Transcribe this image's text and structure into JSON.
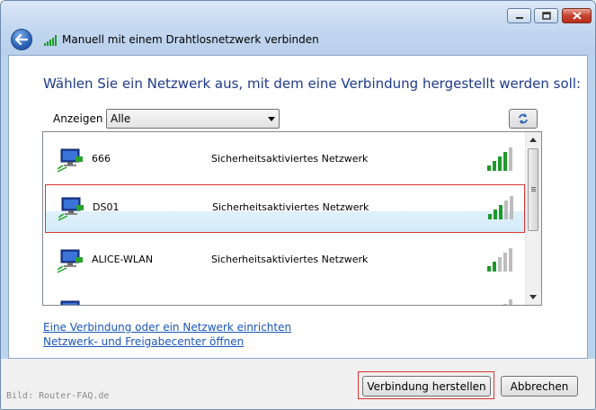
{
  "window": {
    "title": "Manuell mit einem Drahtlosnetzwerk verbinden",
    "controls": [
      "minimize",
      "maximize",
      "close"
    ]
  },
  "main": {
    "heading": "Wählen Sie ein Netzwerk aus, mit dem eine Verbindung hergestellt werden soll:",
    "filter": {
      "label": "Anzeigen",
      "value": "Alle"
    },
    "networks": [
      {
        "name": "666",
        "security": "Sicherheitsaktiviertes Netzwerk",
        "signal_level": 4,
        "selected": false
      },
      {
        "name": "DS01",
        "security": "Sicherheitsaktiviertes Netzwerk",
        "signal_level": 3,
        "selected": true
      },
      {
        "name": "ALICE-WLAN",
        "security": "Sicherheitsaktiviertes Netzwerk",
        "signal_level": 2,
        "selected": false
      }
    ],
    "links": [
      "Eine Verbindung oder ein Netzwerk einrichten",
      "Netzwerk- und Freigabecenter öffnen"
    ]
  },
  "footer": {
    "connect_label": "Verbindung herstellen",
    "cancel_label": "Abbrechen",
    "watermark": "Bild: Router-FAQ.de"
  },
  "colors": {
    "heading": "#1e3a8a",
    "link": "#1a56b8",
    "signal_green": "#1e9a2a",
    "highlight_border": "#dd3333"
  }
}
